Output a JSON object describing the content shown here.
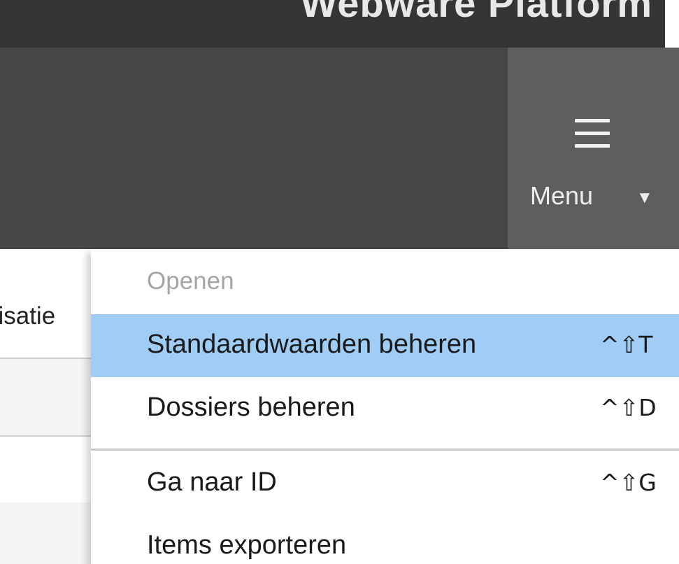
{
  "app": {
    "title": "Webware Platform"
  },
  "header": {
    "menu_label": "Menu",
    "caret": "▼",
    "menu_icon": "hamburger-icon"
  },
  "background": {
    "visible_label_fragment": "nisatie"
  },
  "dropdown": {
    "section_label": "Openen",
    "items": [
      {
        "label": "Standaardwaarden beheren",
        "shortcut": "^⇧T",
        "highlighted": true
      },
      {
        "label": "Dossiers beheren",
        "shortcut": "^⇧D",
        "highlighted": false
      },
      {
        "label": "Ga naar ID",
        "shortcut": "^⇧G",
        "highlighted": false
      },
      {
        "label": "Items exporteren",
        "shortcut": "",
        "highlighted": false
      }
    ]
  },
  "colors": {
    "top_strip": "#353535",
    "header_bar": "#474747",
    "menu_button": "#5e5e5e",
    "highlight": "#9fcdf6",
    "section_label": "#a5a5a5"
  }
}
